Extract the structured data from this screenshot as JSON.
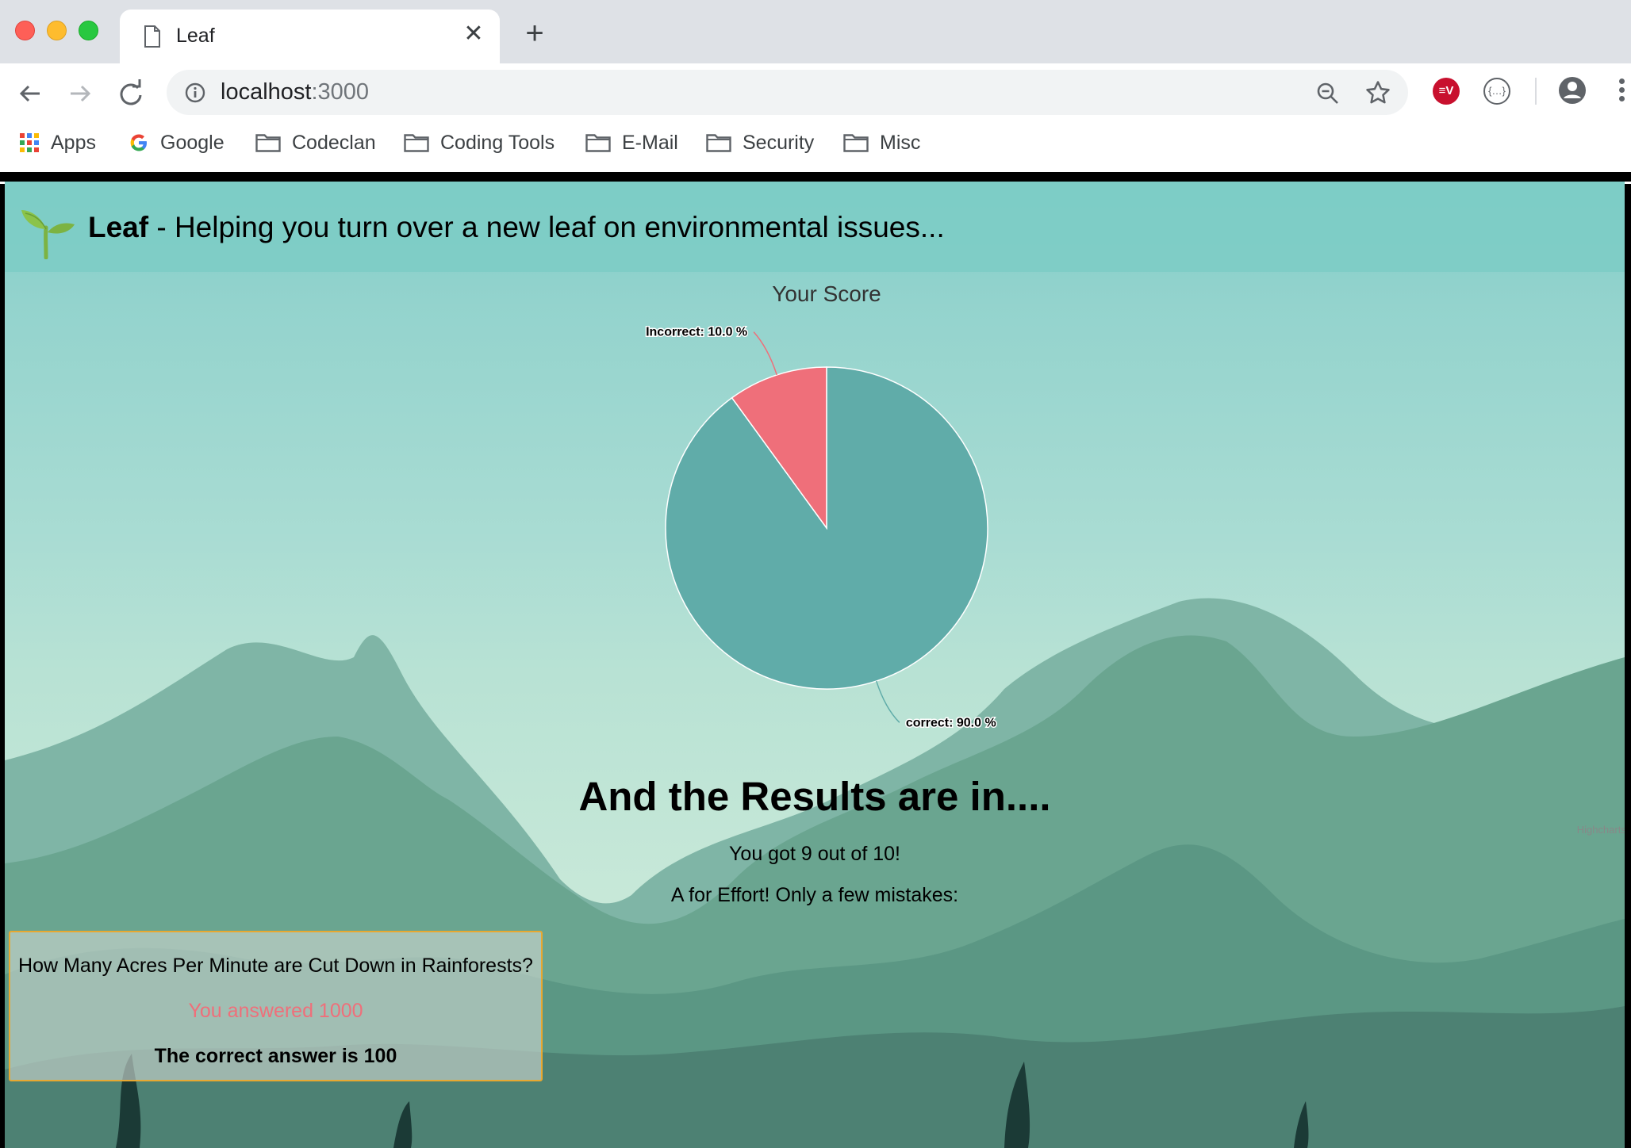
{
  "browser": {
    "tab_title": "Leaf",
    "tab_close": "✕",
    "new_tab": "+",
    "url_host": "localhost",
    "url_port": ":3000",
    "ext_vpn_label": "≡V",
    "ext_json_label": "{…}",
    "bookmarks": [
      {
        "label": "Apps",
        "icon": "apps-grid-icon"
      },
      {
        "label": "Google",
        "icon": "google-icon"
      },
      {
        "label": "Codeclan",
        "icon": "folder-icon"
      },
      {
        "label": "Coding Tools",
        "icon": "folder-icon"
      },
      {
        "label": "E-Mail",
        "icon": "folder-icon"
      },
      {
        "label": "Security",
        "icon": "folder-icon"
      },
      {
        "label": "Misc",
        "icon": "folder-icon"
      }
    ]
  },
  "header": {
    "brand": "Leaf",
    "tagline": " - Helping you turn over a new leaf on environmental issues..."
  },
  "chart_data": {
    "type": "pie",
    "title": "Your Score",
    "slices": [
      {
        "name": "correct",
        "value": 90.0,
        "label": "correct: 90.0 %",
        "color": "#60aca9"
      },
      {
        "name": "Incorrect",
        "value": 10.0,
        "label": "Incorrect: 10.0 %",
        "color": "#ef6f7a"
      }
    ],
    "credits": "Highcharts.com"
  },
  "results": {
    "title": "And the Results are in....",
    "score_text": "You got 9 out of 10!",
    "feedback": "A for Effort! Only a few mistakes:"
  },
  "mistakes": [
    {
      "question": "How Many Acres Per Minute are Cut Down in Rainforests?",
      "your_answer": "You answered 1000",
      "correct_answer": "The correct answer is 100"
    }
  ],
  "colors": {
    "correct": "#60aca9",
    "incorrect": "#ef6f7a",
    "card_border": "#e8a830"
  }
}
